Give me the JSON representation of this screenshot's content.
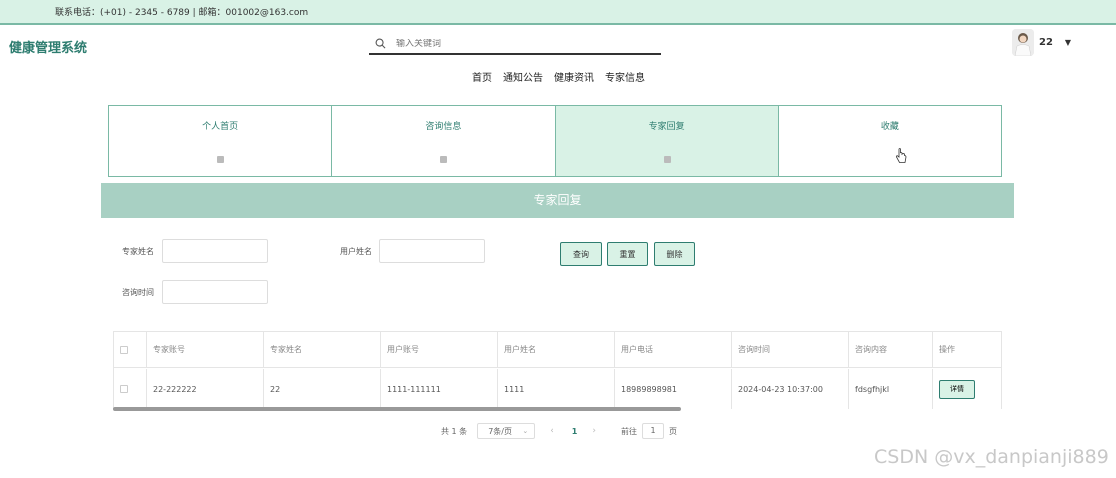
{
  "topbar": {
    "contact": "联系电话：(+01) - 2345 - 6789 | 邮箱：001002@163.com"
  },
  "header": {
    "logo": "健康管理系统",
    "search_placeholder": "输入关键词",
    "user_name": "22"
  },
  "nav": [
    "首页",
    "通知公告",
    "健康资讯",
    "专家信息"
  ],
  "tabs": [
    {
      "label": "个人首页",
      "active": false
    },
    {
      "label": "咨询信息",
      "active": false
    },
    {
      "label": "专家回复",
      "active": true
    },
    {
      "label": "收藏",
      "active": false
    }
  ],
  "banner": {
    "title": "专家回复"
  },
  "filters": {
    "expert_name_label": "专家姓名",
    "user_name_label": "用户姓名",
    "consult_time_label": "咨询时间"
  },
  "buttons": {
    "query": "查询",
    "reset": "重置",
    "delete": "删除"
  },
  "table": {
    "headers": [
      "专家账号",
      "专家姓名",
      "用户账号",
      "用户姓名",
      "用户电话",
      "咨询时间",
      "咨询内容",
      "操作"
    ],
    "rows": [
      [
        "22-222222",
        "22",
        "1111-111111",
        "1111",
        "18989898981",
        "2024-04-23 10:37:00",
        "fdsgfhjkl"
      ]
    ],
    "detail_label": "详情"
  },
  "pager": {
    "total": "共 1 条",
    "page_size": "7条/页",
    "current": "1",
    "goto_label": "前往",
    "goto_value": "1",
    "page_suffix": "页"
  },
  "watermark": "CSDN @vx_danpianji889"
}
